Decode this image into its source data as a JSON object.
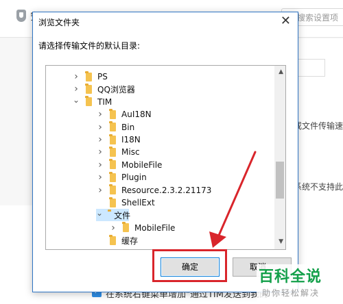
{
  "background_app": {
    "title_fragment": "安",
    "search_placeholder": "搜索设置项",
    "right_text_1": "或文件传输速",
    "right_text_2": "系统不支持此选",
    "bottom_checkbox_label": "在系统右键菜单增加\"通过TIM发送到我的"
  },
  "dialog": {
    "title": "浏览文件夹",
    "close_glyph": "✕",
    "prompt": "请选择传输文件的默认目录:",
    "tree": [
      {
        "label": "PS",
        "level": 1,
        "expanded": false
      },
      {
        "label": "QQ浏览器",
        "level": 1,
        "expanded": false
      },
      {
        "label": "TIM",
        "level": 1,
        "expanded": true
      },
      {
        "label": "AuI18N",
        "level": 2,
        "expanded": false
      },
      {
        "label": "Bin",
        "level": 2,
        "expanded": false
      },
      {
        "label": "I18N",
        "level": 2,
        "expanded": false
      },
      {
        "label": "Misc",
        "level": 2,
        "expanded": false
      },
      {
        "label": "MobileFile",
        "level": 2,
        "expanded": false
      },
      {
        "label": "Plugin",
        "level": 2,
        "expanded": false
      },
      {
        "label": "Resource.2.3.2.21173",
        "level": 2,
        "expanded": false
      },
      {
        "label": "ShellExt",
        "level": 2,
        "expanded": null
      },
      {
        "label": "文件",
        "level": 2,
        "expanded": true,
        "selected": true
      },
      {
        "label": "MobileFile",
        "level": 3,
        "expanded": false
      },
      {
        "label": "缓存",
        "level": 2,
        "expanded": null
      }
    ],
    "ok_label": "确定",
    "cancel_label": "取消"
  },
  "watermark": {
    "logo": "百科全说",
    "subtitle": "助你轻松解决"
  },
  "colors": {
    "accent": "#0078d7",
    "annotation_red": "#d9252b",
    "watermark_green": "#13a04a",
    "folder_yellow": "#f5c350",
    "selection": "#cce8ff"
  }
}
